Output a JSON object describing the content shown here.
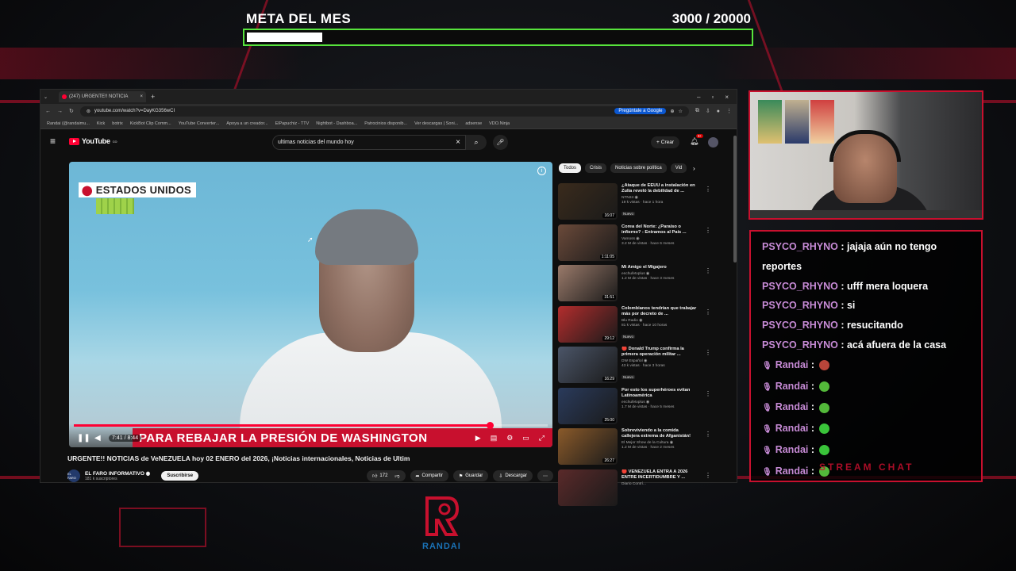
{
  "goal": {
    "title": "META DEL MES",
    "count": "3000  / 20000",
    "progress": 0.15,
    "bar_color": "#57e33c"
  },
  "browser": {
    "tab_title": "(247) URGENTE!! NOTICIA",
    "url": "youtube.com/watch?v=DayKG356wCI",
    "gemini_button": "Pregúntale a Google",
    "bookmarks": [
      "Randai (@randaimu...",
      "Kick",
      "botrix",
      "KickBot Clip Comm...",
      "YouTube Converter...",
      "Apoya a un creador...",
      "ElPapuchiz - TTV",
      "Nightbot - Dashboa...",
      "Patrocinios disponib...",
      "Ver descargas | Soni...",
      "adsense",
      "VDO.Ninja"
    ]
  },
  "youtube": {
    "logo": "YouTube",
    "logo_sup": "CO",
    "search_value": "ultimas noticias del mundo hoy",
    "create_label": "Crear",
    "notif_count": "9+",
    "video": {
      "location_tag": "ESTADOS UNIDOS",
      "lower_third": "PARA REBAJAR LA PRESIÓN DE WASHINGTON",
      "time": "7:41 / 8:44",
      "progress": 0.88,
      "title": "URGENTE!! NOTICIAS de VeNEZUELA hoy 02 ENERO del 2026, ¡Noticias internacionales, Noticias de Ultim",
      "channel_name": "EL FARO INFORMATIVO ◉",
      "channel_avatar": "EL FARO",
      "channel_subs": "181 k suscriptores",
      "subscribe": "Suscribirse",
      "likes": "172",
      "share": "Compartir",
      "save": "Guardar",
      "download": "Descargar"
    },
    "chips": [
      "Todos",
      "Crisis",
      "Noticias sobre política",
      "Vid"
    ],
    "recommendations": [
      {
        "title": "¿Ataque de EEUU a instalación en Zulia reveló la debilidad de ...",
        "channel": "NTN24 ◉",
        "stats": "19 k vistas · hace 1 hora",
        "badge": "Nuevo",
        "duration": "16:07",
        "color": "#3a2b1c"
      },
      {
        "title": "Corea del Norte: ¿Paraíso o infierno? - Entramos al País ...",
        "channel": "Vamoss ◉",
        "stats": "3.2 M de vistas · hace 6 meses",
        "badge": "",
        "duration": "1:11:05",
        "color": "#6b4a3a"
      },
      {
        "title": "Mi Amigo el Migajero",
        "channel": "enchufetvplus ◉",
        "stats": "1.2 M de vistas · hace 3 meses",
        "badge": "",
        "duration": "31:51",
        "color": "#9a7a6a"
      },
      {
        "title": "Colombianos tendrían que trabajar más por decreto de ...",
        "channel": "Blu Radio ◉",
        "stats": "81 k vistas · hace 10 horas",
        "badge": "Nuevo",
        "duration": "29:12",
        "color": "#b32d2d"
      },
      {
        "title": "🔴 Donald Trump confirma la primera operación militar ...",
        "channel": "DW Español ◉",
        "stats": "43 k vistas · hace 3 horas",
        "badge": "Nuevo",
        "duration": "16:29",
        "color": "#4b5568"
      },
      {
        "title": "Por esto los superhéroes evitan Latinoamérica",
        "channel": "enchufetvplus ◉",
        "stats": "1.7 M de vistas · hace 5 meses",
        "badge": "",
        "duration": "25:00",
        "color": "#2a3b5c"
      },
      {
        "title": "Sobreviviendo a la comida callejera extrema de Afganistán!",
        "channel": "El Mejor Show de la Cultura ◉",
        "stats": "1.2 M de vistas · hace 2 meses",
        "badge": "",
        "duration": "26:27",
        "color": "#8a5a2a"
      },
      {
        "title": "🔴 VENEZUELA ENTRA A 2026 ENTRE INCERTIDUMBRE Y ...",
        "channel": "Diario Contrí...",
        "stats": "",
        "badge": "",
        "duration": "",
        "color": "#5a2a2a"
      }
    ]
  },
  "chat": {
    "messages": [
      {
        "user": "PSYCO_RHYNO",
        "text": " : jajaja aún no tengo reportes",
        "mic": false,
        "emote": ""
      },
      {
        "user": "PSYCO_RHYNO",
        "text": " : ufff mera loquera",
        "mic": false,
        "emote": ""
      },
      {
        "user": "PSYCO_RHYNO",
        "text": " : si",
        "mic": false,
        "emote": ""
      },
      {
        "user": "PSYCO_RHYNO",
        "text": " : resucitando",
        "mic": false,
        "emote": ""
      },
      {
        "user": "PSYCO_RHYNO",
        "text": " : acá afuera de la casa",
        "mic": false,
        "emote": ""
      },
      {
        "user": "Randai",
        "text": " : ",
        "mic": true,
        "emote": "#b8453a"
      },
      {
        "user": "Randai",
        "text": " : ",
        "mic": true,
        "emote": "#53b83a"
      },
      {
        "user": "Randai",
        "text": " : ",
        "mic": true,
        "emote": "#53b83a"
      },
      {
        "user": "Randai",
        "text": " : ",
        "mic": true,
        "emote": "#3ac43a"
      },
      {
        "user": "Randai",
        "text": " : ",
        "mic": true,
        "emote": "#3ac43a"
      },
      {
        "user": "Randai",
        "text": " : ",
        "mic": true,
        "emote": "#53b83a"
      }
    ],
    "footer": "STREAM CHAT",
    "accent": "#c8102e"
  },
  "brand": {
    "logo_text": "RANDAI"
  }
}
